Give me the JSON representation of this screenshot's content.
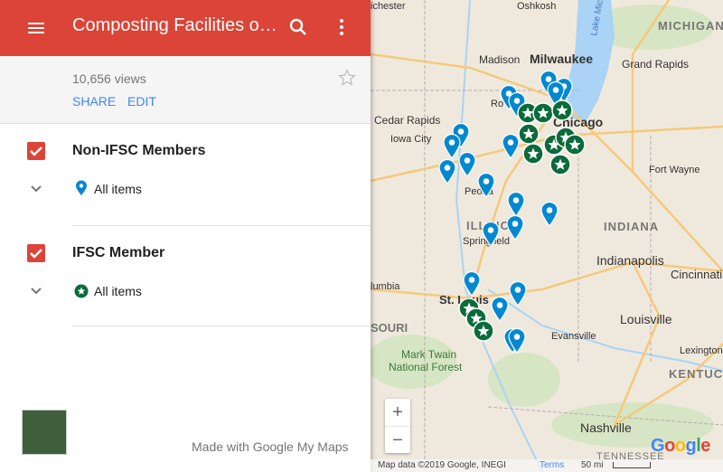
{
  "header": {
    "title": "Composting Facilities o…",
    "menu_icon": "menu-icon",
    "search_icon": "search-icon",
    "more_icon": "more-vert-icon"
  },
  "info": {
    "views": "10,656 views",
    "share_label": "SHARE",
    "edit_label": "EDIT"
  },
  "layers": [
    {
      "title": "Non-IFSC Members",
      "items_label": "All items",
      "icon": "blue-pin-icon",
      "checked": true
    },
    {
      "title": "IFSC Member",
      "items_label": "All items",
      "icon": "green-star-icon",
      "checked": true
    }
  ],
  "footer": {
    "made_with": "Made with Google My Maps"
  },
  "map": {
    "place_labels": [
      "Milwaukee",
      "Madison",
      "Oshkosh",
      "Grand Rapids",
      "MICHIGAN",
      "Lake Michigan",
      "Cedar Rapids",
      "Iowa City",
      "Chicago",
      "Fort Wayne",
      "Peoria",
      "ILLINOIS",
      "Springfield",
      "INDIANA",
      "Indianapolis",
      "Cincinnati",
      "St. Louis",
      "Louisville",
      "Lexington",
      "Evansville",
      "Mark Twain National Forest",
      "KENTUCKY",
      "Nashville",
      "TENNESSEE",
      "SOURI",
      "lumbia",
      "ichester",
      "Ro"
    ],
    "zoom_in": "+",
    "zoom_out": "−",
    "attribution": "Map data ©2019 Google, INEGI",
    "terms": "Terms",
    "scale": "50 mi",
    "logo": "Google"
  },
  "colors": {
    "header": "#db4437",
    "link": "#4285f4",
    "blue_pin": "#0288d1",
    "green_star": "#0b6b3a"
  }
}
